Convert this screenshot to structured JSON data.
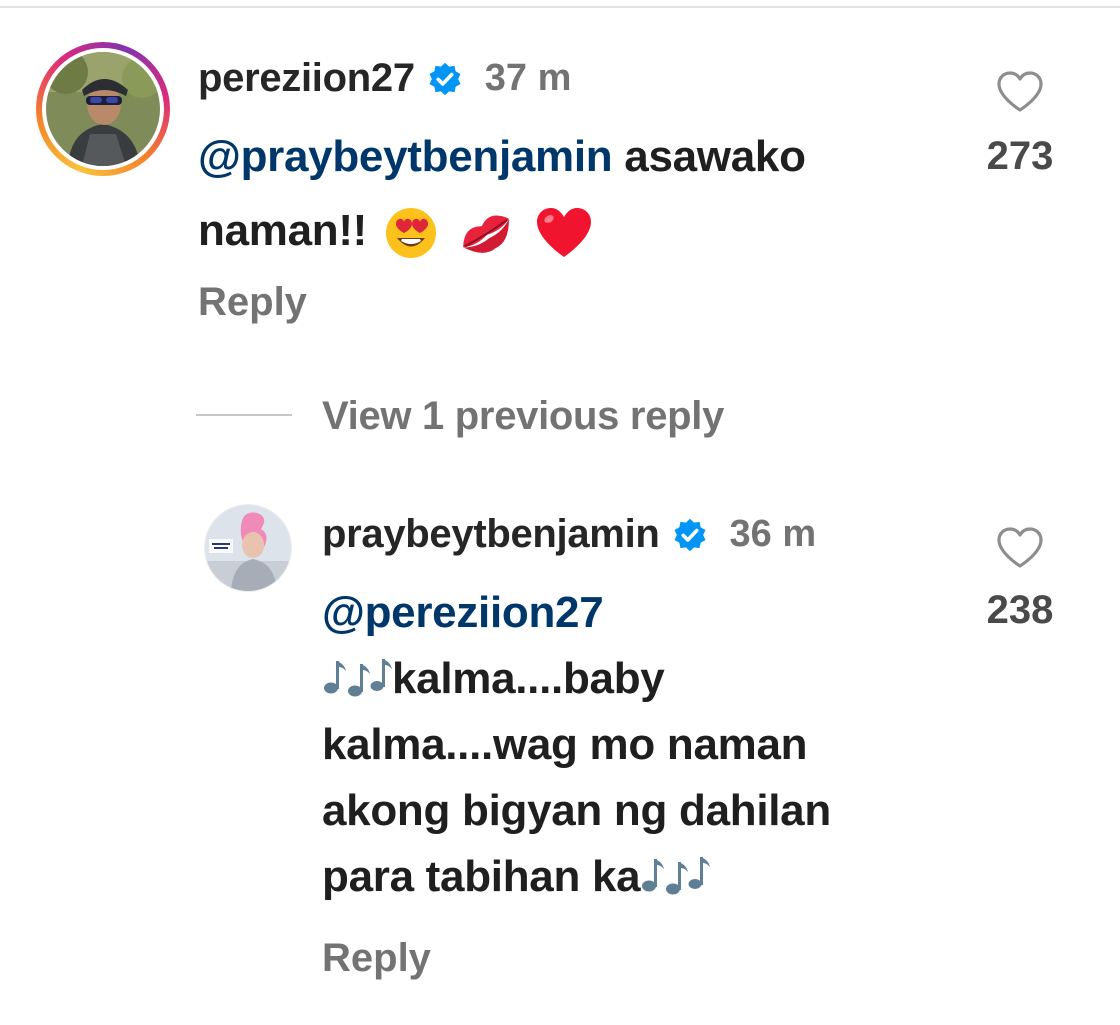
{
  "comments": [
    {
      "username": "pereziion27",
      "verified": true,
      "time": "37 m",
      "mention": "@praybeytbenjamin",
      "text_line1": " asawako",
      "text_line2": "naman!!",
      "emojis": [
        "heart-eyes-emoji",
        "kiss-lips-emoji",
        "red-heart-emoji"
      ],
      "likes": "273",
      "reply_label": "Reply"
    },
    {
      "username": "praybeytbenjamin",
      "verified": true,
      "time": "36 m",
      "mention": "@pereziion27",
      "lines": [
        "kalma....baby",
        "kalma....wag mo naman",
        "akong bigyan ng dahilan",
        "para tabihan ka"
      ],
      "emojis": [
        "musical-notes-emoji",
        "musical-notes-emoji"
      ],
      "likes": "238",
      "reply_label": "Reply"
    }
  ],
  "view_replies": {
    "label": "View 1 previous reply"
  },
  "colors": {
    "mention": "#00376b",
    "secondary_text": "#737373",
    "verified_badge": "#0095f6",
    "story_ring": [
      "#f9c23c",
      "#f58529",
      "#dd2a7b",
      "#8134af"
    ]
  },
  "icons": [
    "heart-outline-icon",
    "verified-badge-icon"
  ]
}
